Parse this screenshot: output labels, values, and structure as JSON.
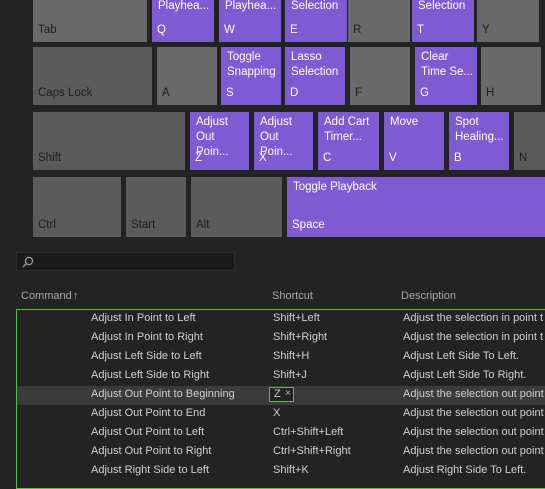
{
  "keys": [
    {
      "id": "tab",
      "label": "Tab",
      "command": ""
    },
    {
      "id": "q",
      "label": "Q",
      "command": "Playhea..."
    },
    {
      "id": "w",
      "label": "W",
      "command": "Playhea..."
    },
    {
      "id": "e",
      "label": "E",
      "command": "Selection"
    },
    {
      "id": "r",
      "label": "R",
      "command": ""
    },
    {
      "id": "t",
      "label": "T",
      "command": "Selection"
    },
    {
      "id": "y",
      "label": "Y",
      "command": ""
    },
    {
      "id": "caps",
      "label": "Caps Lock",
      "command": ""
    },
    {
      "id": "a",
      "label": "A",
      "command": ""
    },
    {
      "id": "s",
      "label": "S",
      "command": "Toggle\nSnapping"
    },
    {
      "id": "d",
      "label": "D",
      "command": "Lasso\nSelection"
    },
    {
      "id": "f",
      "label": "F",
      "command": ""
    },
    {
      "id": "g",
      "label": "G",
      "command": "Clear\nTime Se..."
    },
    {
      "id": "h",
      "label": "H",
      "command": ""
    },
    {
      "id": "shift",
      "label": "Shift",
      "command": ""
    },
    {
      "id": "z",
      "label": "Z",
      "command": "Adjust\nOut\nPoin..."
    },
    {
      "id": "x",
      "label": "X",
      "command": "Adjust\nOut\nPoin..."
    },
    {
      "id": "c",
      "label": "C",
      "command": "Add Cart\nTimer..."
    },
    {
      "id": "v",
      "label": "V",
      "command": "Move"
    },
    {
      "id": "b",
      "label": "B",
      "command": "Spot\nHealing..."
    },
    {
      "id": "n",
      "label": "N",
      "command": ""
    },
    {
      "id": "ctrl",
      "label": "Ctrl",
      "command": ""
    },
    {
      "id": "start",
      "label": "Start",
      "command": ""
    },
    {
      "id": "alt",
      "label": "Alt",
      "command": ""
    },
    {
      "id": "space",
      "label": "Space",
      "command": "Toggle Playback"
    }
  ],
  "search": {
    "placeholder": "",
    "value": ""
  },
  "columns": {
    "command": "Command",
    "sort_glyph": "↑",
    "shortcut": "Shortcut",
    "description": "Description"
  },
  "rows": [
    {
      "command": "Adjust In Point to Left",
      "shortcut": "Shift+Left",
      "description": "Adjust the selection in point t"
    },
    {
      "command": "Adjust In Point to Right",
      "shortcut": "Shift+Right",
      "description": "Adjust the selection in point t"
    },
    {
      "command": "Adjust Left Side to Left",
      "shortcut": "Shift+H",
      "description": "Adjust Left Side To Left."
    },
    {
      "command": "Adjust Left Side to Right",
      "shortcut": "Shift+J",
      "description": "Adjust Left Side To Right."
    },
    {
      "command": "Adjust Out Point to Beginning",
      "shortcut": "Z",
      "description": "Adjust the selection out point",
      "editing": true
    },
    {
      "command": "Adjust Out Point to End",
      "shortcut": "X",
      "description": "Adjust the selection out point"
    },
    {
      "command": "Adjust Out Point to Left",
      "shortcut": "Ctrl+Shift+Left",
      "description": "Adjust the selection out point"
    },
    {
      "command": "Adjust Out Point to Right",
      "shortcut": "Ctrl+Shift+Right",
      "description": "Adjust the selection out point"
    },
    {
      "command": "Adjust Right Side to Left",
      "shortcut": "Shift+K",
      "description": "Adjust Right Side To Left."
    }
  ],
  "chip_remove_glyph": "×",
  "colors": {
    "assigned_key": "#7e5bd2",
    "unassigned_key": "#5b5b5b",
    "focus_outline": "#55c23a"
  }
}
